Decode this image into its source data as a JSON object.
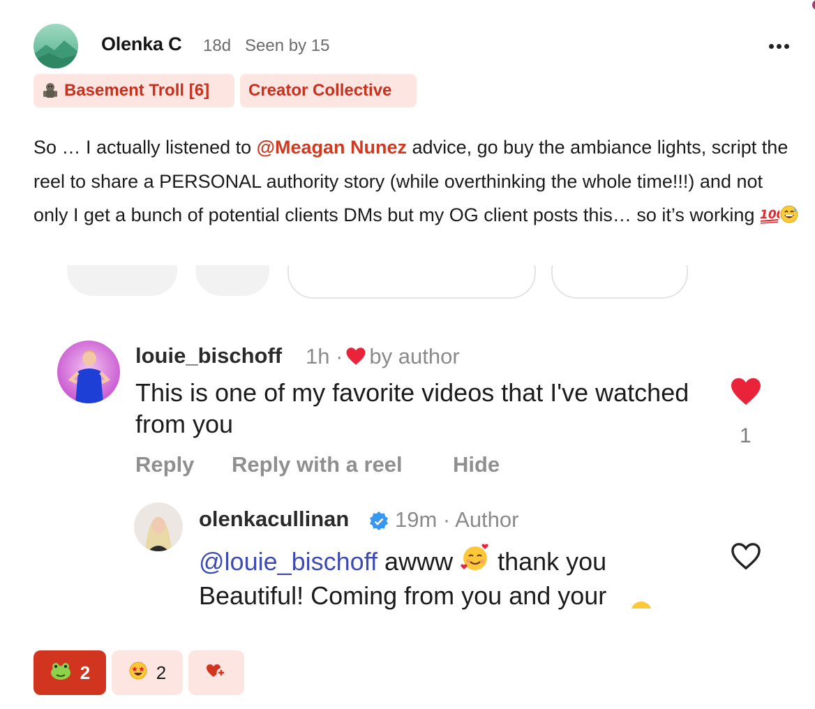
{
  "post": {
    "author": "Olenka C",
    "age": "18d",
    "seen": "Seen by 15",
    "badges": {
      "troll": "Basement Troll [6]",
      "creator": "Creator Collective"
    },
    "body": {
      "part1": "So … I actually listened to ",
      "mention": "@Meagan Nunez",
      "part2": " advice, go buy the ambiance lights, script the reel to share a PERSONAL authority story (while overthinking the whole time!!!) and not only I get a bunch of potential clients DMs but my OG client posts this… so it’s working ",
      "emoji_icons": [
        "hundred-points-icon",
        "grinning-sweat-icon"
      ]
    }
  },
  "embed": {
    "comment1": {
      "user": "louie_bischoff",
      "meta_time": "1h ·",
      "meta_by": "by author",
      "text": "This is one of my favorite videos that I've watched from you",
      "like_count": "1",
      "actions": {
        "reply": "Reply",
        "reply_reel": "Reply with a reel",
        "hide": "Hide"
      }
    },
    "comment2": {
      "user": "olenkacullinan",
      "meta": "19m · Author",
      "mention": "@louie_bischoff",
      "text_a": " awww ",
      "text_b": " thank you Beautiful! Coming from you and your"
    }
  },
  "reactions": [
    {
      "icon": "frog-emoji-icon",
      "count": "2"
    },
    {
      "icon": "star-struck-emoji-icon",
      "count": "2"
    },
    {
      "icon": "add-heart-icon",
      "count": ""
    }
  ],
  "colors": {
    "accent": "#d2351f",
    "badge_bg": "#fde5e2",
    "mention_blue": "#3d4bb3",
    "heart_red": "#e8233a"
  }
}
